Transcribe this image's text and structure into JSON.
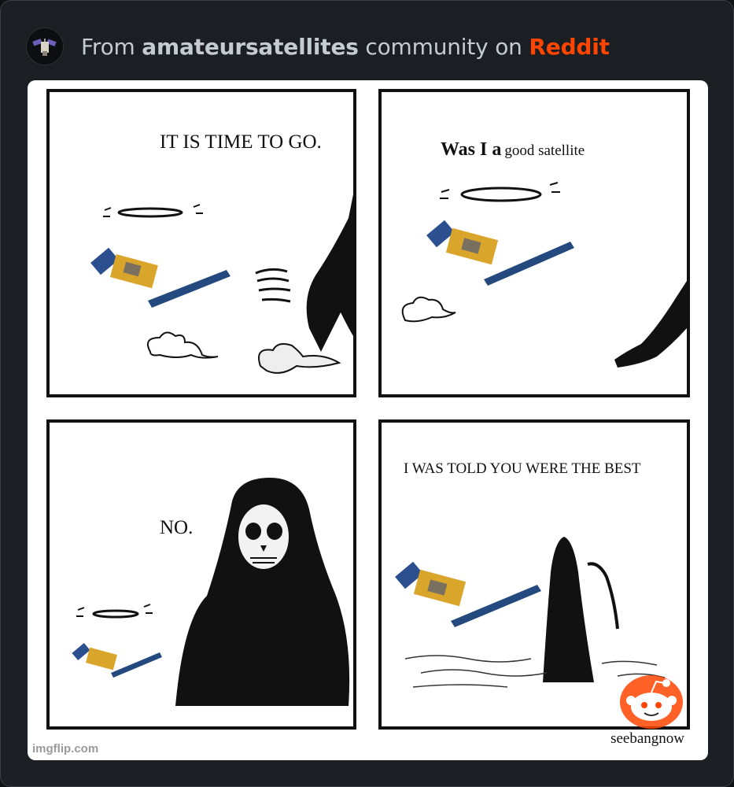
{
  "header": {
    "prefix": "From ",
    "community": "amateursatellites",
    "middle": " community on ",
    "brand": "Reddit",
    "brand_color": "#ff4500",
    "avatar_icon": "satellite-avatar-icon"
  },
  "comic": {
    "panel1_text": "IT IS TIME TO GO.",
    "panel2_text_bold": "Was I a",
    "panel2_text_rest": "good satellite",
    "panel3_text": "NO.",
    "panel4_text": "I WAS TOLD YOU WERE THE BEST",
    "watermark": "imgflip.com",
    "credit": "seebangnow",
    "logo_icon": "reddit-snoo-icon"
  }
}
